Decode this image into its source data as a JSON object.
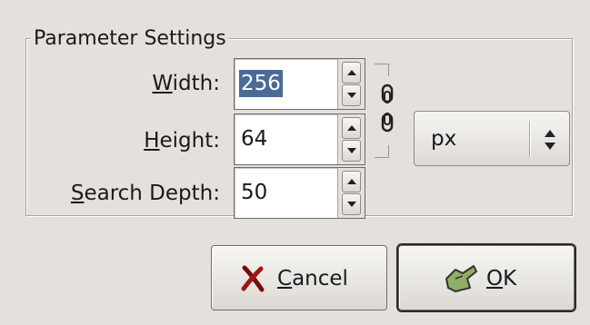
{
  "dialog": {
    "group_title": "Parameter Settings",
    "fields": [
      {
        "label_mnemonic": "W",
        "label_rest": "idth:",
        "value": "256"
      },
      {
        "label_mnemonic": "H",
        "label_rest": "eight:",
        "value": "64"
      },
      {
        "label_mnemonic": "S",
        "label_rest": "earch Depth:",
        "value": "50"
      }
    ],
    "unit": "px",
    "buttons": {
      "cancel_mnemonic": "C",
      "cancel_rest": "ancel",
      "ok_mnemonic": "O",
      "ok_rest": "K"
    },
    "colors": {
      "selection": "#4a6b97",
      "background": "#e4e1dc"
    },
    "icons": {
      "chain": "chain-link-icon",
      "cancel": "cancel-x-icon",
      "ok": "ok-hand-icon"
    }
  }
}
